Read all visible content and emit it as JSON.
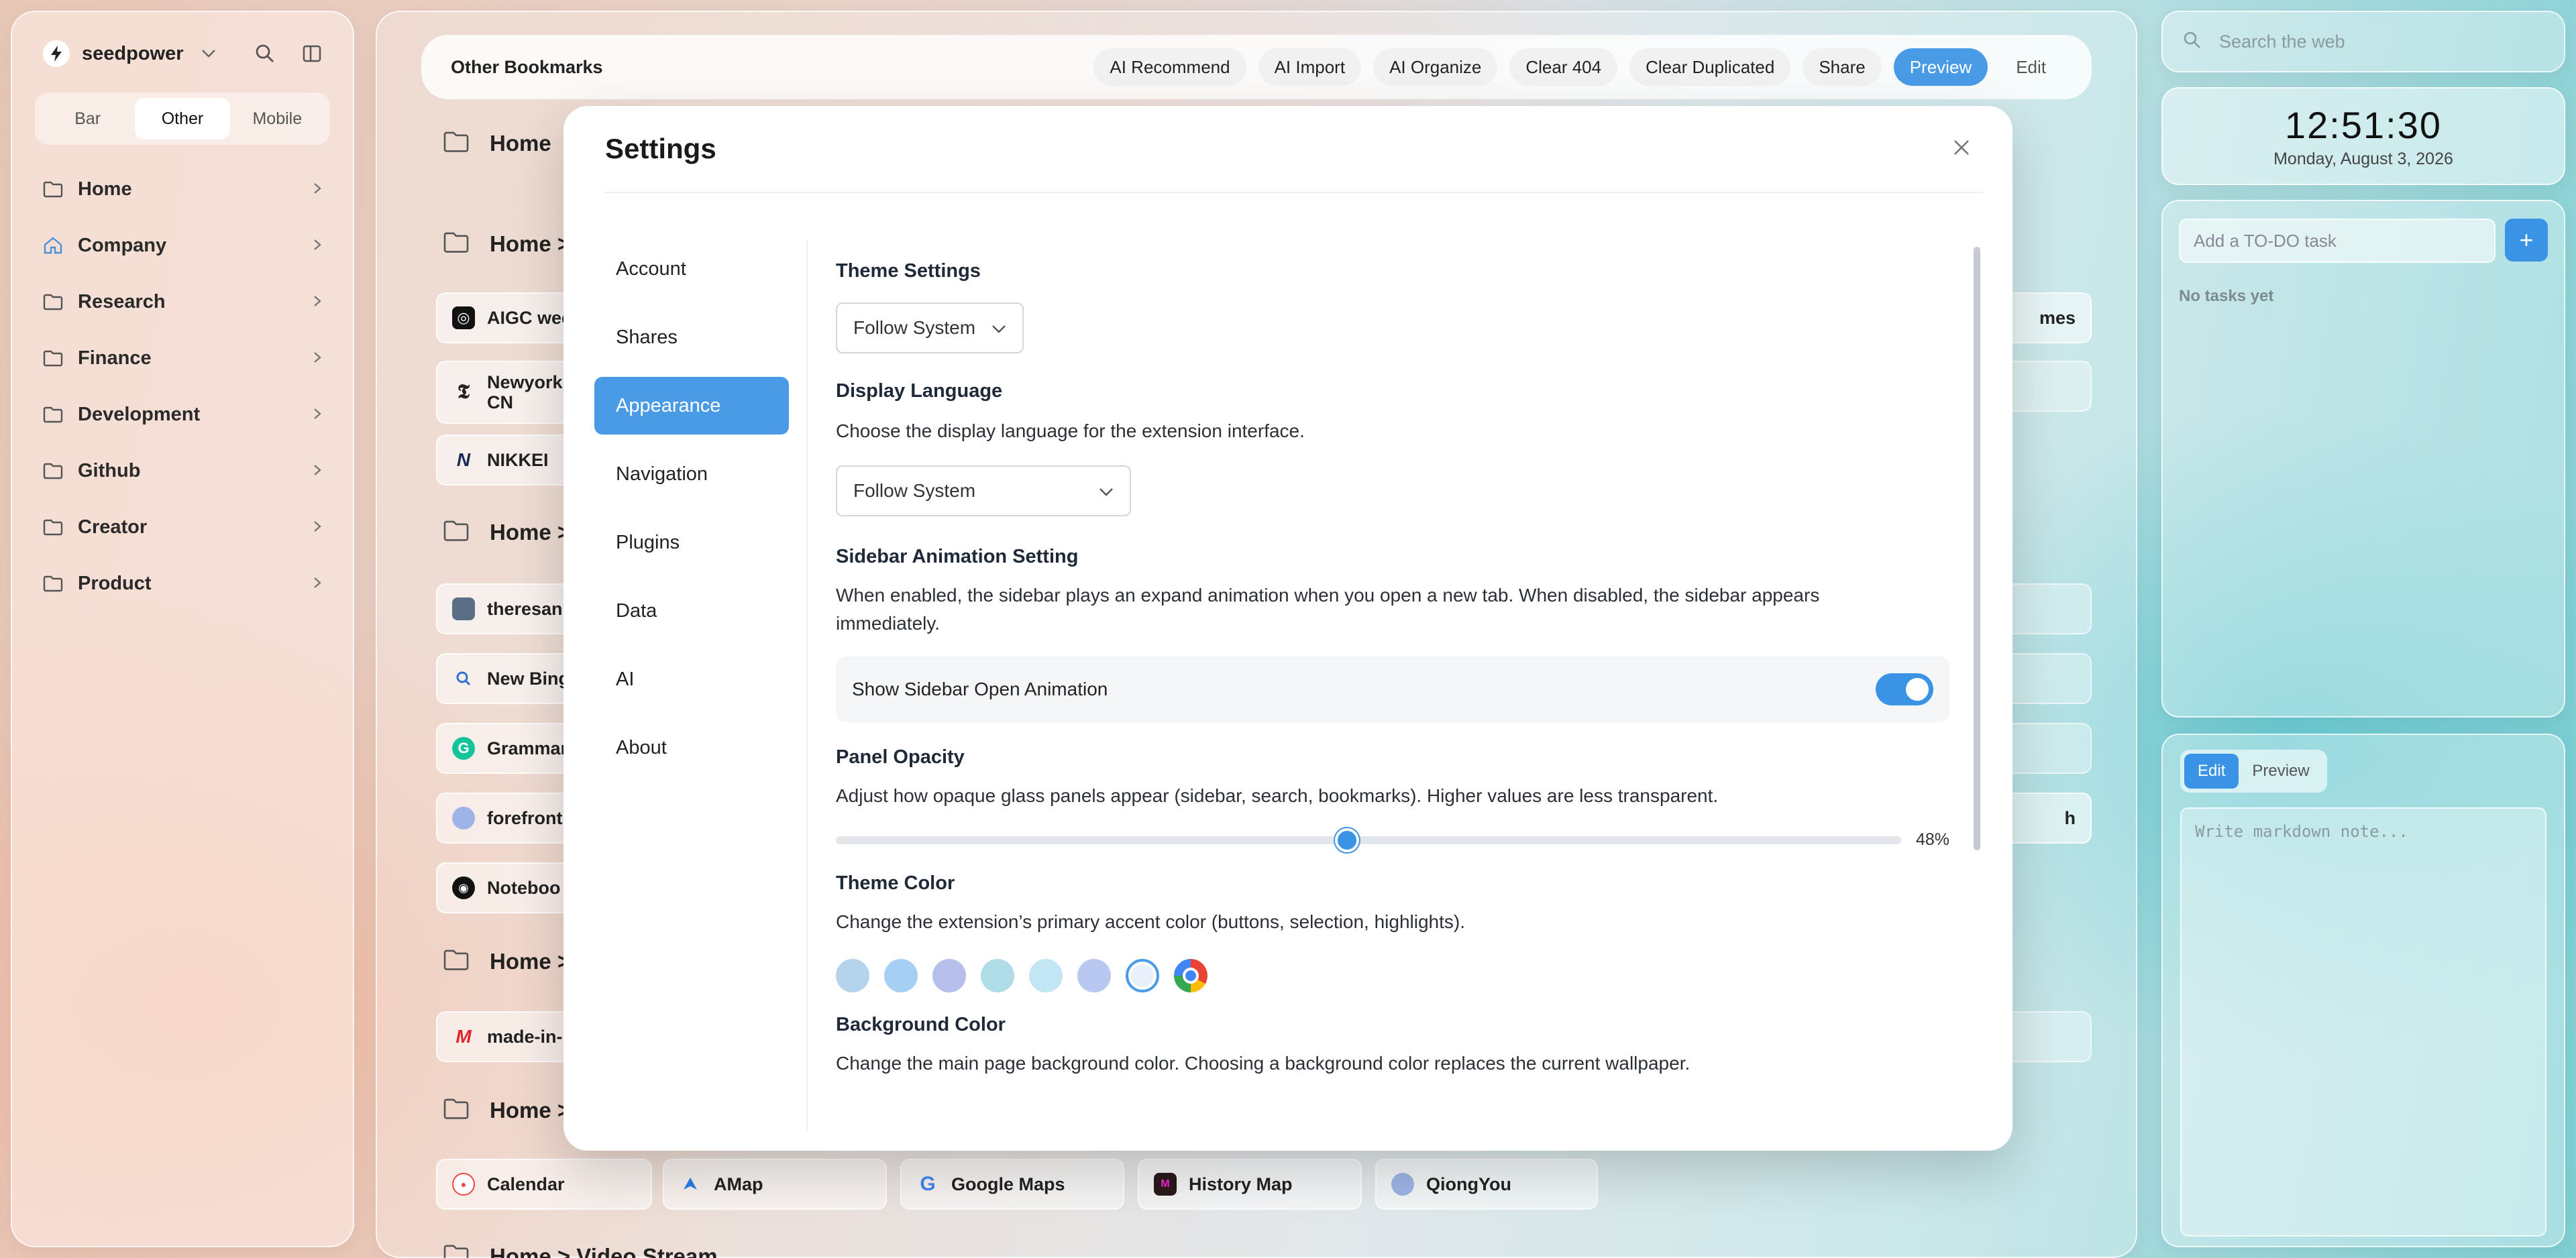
{
  "sidebar": {
    "user": "seedpower",
    "segments": [
      "Bar",
      "Other",
      "Mobile"
    ],
    "active_segment": "Other",
    "items": [
      {
        "label": "Home",
        "icon": "folder-icon"
      },
      {
        "label": "Company",
        "icon": "home-icon"
      },
      {
        "label": "Research",
        "icon": "folder-icon"
      },
      {
        "label": "Finance",
        "icon": "folder-icon"
      },
      {
        "label": "Development",
        "icon": "folder-icon"
      },
      {
        "label": "Github",
        "icon": "folder-icon"
      },
      {
        "label": "Creator",
        "icon": "folder-icon"
      },
      {
        "label": "Product",
        "icon": "folder-icon"
      }
    ]
  },
  "topbar": {
    "title": "Other Bookmarks",
    "actions": [
      "AI Recommend",
      "AI Import",
      "AI Organize",
      "Clear 404",
      "Clear Duplicated",
      "Share",
      "Preview",
      "Edit"
    ],
    "active_action": "Preview"
  },
  "main": {
    "groups": [
      "Home",
      "Home >",
      "Home >",
      "Home >",
      "Home >",
      "Home > Video Stream"
    ],
    "bookmarks": {
      "aigc": "AIGC wee",
      "newyork": "Newyork\nCN",
      "nikkei": "NIKKEI",
      "theresan": "theresan",
      "newbing": "New Bing",
      "grammarly": "Grammar",
      "forefront": "forefront",
      "notebook": "Noteboo",
      "madein": "made-in-",
      "calendar": "Calendar",
      "amap": "AMap",
      "googlemaps": "Google Maps",
      "historymap": "History Map",
      "qiongyou": "QiongYou",
      "right_partial_1": "mes",
      "right_partial_2": "h"
    }
  },
  "search": {
    "placeholder": "Search the web"
  },
  "clock": {
    "time": "12:51:30",
    "date": "Monday, August 3, 2026"
  },
  "todo": {
    "placeholder": "Add a TO-DO task",
    "add": "+",
    "empty": "No tasks yet"
  },
  "notes": {
    "tabs": [
      "Edit",
      "Preview"
    ],
    "active_tab": "Edit",
    "placeholder": "Write markdown note..."
  },
  "settings": {
    "title": "Settings",
    "nav": [
      "Account",
      "Shares",
      "Appearance",
      "Navigation",
      "Plugins",
      "Data",
      "AI",
      "About"
    ],
    "active_nav": "Appearance",
    "theme": {
      "title": "Theme Settings",
      "value": "Follow System"
    },
    "language": {
      "title": "Display Language",
      "desc": "Choose the display language for the extension interface.",
      "value": "Follow System"
    },
    "sidebar_anim": {
      "title": "Sidebar Animation Setting",
      "desc": "When enabled, the sidebar plays an expand animation when you open a new tab. When disabled, the sidebar appears immediately.",
      "toggle_label": "Show Sidebar Open Animation",
      "enabled": true
    },
    "opacity": {
      "title": "Panel Opacity",
      "desc": "Adjust how opaque glass panels appear (sidebar, search, bookmarks). Higher values are less transparent.",
      "value": 0.48,
      "value_label": "48%"
    },
    "theme_color": {
      "title": "Theme Color",
      "desc": "Change the extension’s primary accent color (buttons, selection, highlights).",
      "swatches": [
        "#b6d3ee",
        "#a6d0f3",
        "#b5bfea",
        "#b0dce7",
        "#c3e6f4",
        "#b9c8f0",
        "#e8f1fb",
        "conic"
      ],
      "selected_index": 6
    },
    "background_color": {
      "title": "Background Color",
      "desc": "Change the main page background color. Choosing a background color replaces the current wallpaper."
    }
  },
  "colors": {
    "accent": "#4a9be6"
  }
}
